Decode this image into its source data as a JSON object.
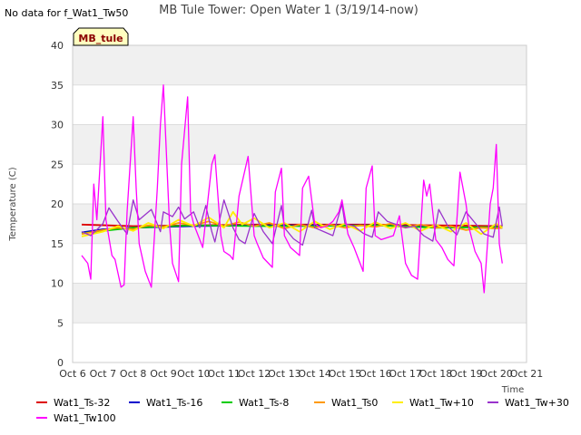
{
  "chart_data": {
    "type": "line",
    "title": "MB Tule Tower: Open Water 1 (3/19/14-now)",
    "no_data_note": "No data for f_Wat1_Tw50",
    "badge": "MB_tule",
    "xlabel": "Time",
    "ylabel": "Temperature (C)",
    "xlim": [
      6,
      21
    ],
    "ylim": [
      0,
      40
    ],
    "x_ticks": [
      6,
      7,
      8,
      9,
      10,
      11,
      12,
      13,
      14,
      15,
      16,
      17,
      18,
      19,
      20,
      21
    ],
    "x_tick_labels": [
      "Oct 6",
      "Oct 7",
      "Oct 8",
      "Oct 9",
      "Oct 10",
      "Oct 11",
      "Oct 12",
      "Oct 13",
      "Oct 14",
      "Oct 15",
      "Oct 16",
      "Oct 17",
      "Oct 18",
      "Oct 19",
      "Oct 20",
      "Oct 21"
    ],
    "y_ticks": [
      0,
      5,
      10,
      15,
      20,
      25,
      30,
      35,
      40
    ],
    "y_tick_labels": [
      "0",
      "5",
      "10",
      "15",
      "20",
      "25",
      "30",
      "35",
      "40"
    ],
    "grid": true,
    "legend_position": "bottom",
    "series": [
      {
        "name": "Wat1_Ts-32",
        "color": "#dd0000",
        "x": [
          6.3,
          8.0,
          10.0,
          12.0,
          14.0,
          16.0,
          18.0,
          20.2
        ],
        "y": [
          17.4,
          17.2,
          17.3,
          17.4,
          17.4,
          17.4,
          17.3,
          17.2
        ]
      },
      {
        "name": "Wat1_Ts-16",
        "color": "#0000cc",
        "x": [
          6.3,
          7.0,
          8.0,
          10.0,
          12.0,
          14.0,
          16.0,
          18.0,
          20.2
        ],
        "y": [
          16.4,
          16.8,
          17.0,
          17.2,
          17.3,
          17.3,
          17.3,
          17.1,
          17.0
        ]
      },
      {
        "name": "Wat1_Ts-8",
        "color": "#00cc00",
        "x": [
          6.3,
          7.0,
          8.0,
          10.0,
          12.0,
          14.0,
          16.0,
          18.0,
          20.2
        ],
        "y": [
          16.3,
          16.6,
          17.0,
          17.3,
          17.2,
          17.2,
          17.3,
          17.0,
          17.1
        ]
      },
      {
        "name": "Wat1_Ts0",
        "color": "#ff9900",
        "x": [
          6.3,
          7.0,
          7.5,
          8.0,
          8.5,
          9.0,
          9.5,
          10.0,
          10.5,
          11.0,
          11.5,
          12.0,
          12.5,
          13.0,
          13.5,
          14.0,
          14.5,
          15.0,
          15.5,
          16.0,
          16.5,
          17.0,
          17.5,
          18.0,
          18.5,
          19.0,
          19.5,
          20.0,
          20.2
        ],
        "y": [
          16.2,
          16.7,
          17.0,
          16.8,
          17.3,
          17.1,
          17.6,
          17.3,
          17.8,
          17.2,
          17.7,
          17.2,
          17.6,
          16.9,
          17.4,
          17.0,
          17.4,
          17.0,
          17.3,
          17.1,
          17.5,
          17.0,
          17.4,
          17.0,
          17.2,
          16.7,
          17.0,
          16.9,
          17.0
        ]
      },
      {
        "name": "Wat1_Tw+10",
        "color": "#ffee00",
        "x": [
          6.3,
          7.0,
          7.5,
          8.0,
          8.5,
          9.0,
          9.5,
          10.0,
          10.5,
          11.0,
          11.3,
          11.6,
          12.0,
          12.5,
          13.0,
          13.5,
          14.0,
          14.5,
          15.0,
          15.5,
          16.0,
          16.5,
          17.0,
          17.5,
          18.0,
          18.5,
          19.0,
          19.5,
          20.0,
          20.2
        ],
        "y": [
          15.9,
          16.5,
          17.2,
          16.6,
          17.6,
          16.9,
          18.0,
          17.2,
          18.3,
          17.0,
          19.0,
          17.4,
          18.2,
          17.0,
          17.6,
          16.5,
          17.8,
          16.8,
          17.5,
          16.6,
          17.7,
          16.9,
          17.6,
          16.6,
          17.4,
          16.5,
          17.6,
          16.2,
          17.5,
          17.0
        ]
      },
      {
        "name": "Wat1_Tw+30",
        "color": "#9933cc",
        "x": [
          6.3,
          6.6,
          7.0,
          7.2,
          7.5,
          7.8,
          8.0,
          8.2,
          8.6,
          8.9,
          9.0,
          9.3,
          9.5,
          9.7,
          10.0,
          10.2,
          10.4,
          10.6,
          10.7,
          11.0,
          11.3,
          11.5,
          11.7,
          12.0,
          12.3,
          12.6,
          12.9,
          13.0,
          13.3,
          13.6,
          13.9,
          14.0,
          14.3,
          14.6,
          14.9,
          15.0,
          15.3,
          15.6,
          15.9,
          16.1,
          16.4,
          16.7,
          17.0,
          17.3,
          17.6,
          17.9,
          18.1,
          18.4,
          18.7,
          19.0,
          19.3,
          19.6,
          19.9,
          20.1,
          20.2
        ],
        "y": [
          16.5,
          16.0,
          17.5,
          19.5,
          17.8,
          16.2,
          20.5,
          18.0,
          19.3,
          16.5,
          19.0,
          18.4,
          19.6,
          18.1,
          19.0,
          17.0,
          19.8,
          16.5,
          15.2,
          20.5,
          17.0,
          15.5,
          15.0,
          18.8,
          16.5,
          15.0,
          19.8,
          17.0,
          15.6,
          14.8,
          19.2,
          17.0,
          16.5,
          16.0,
          20.0,
          17.5,
          17.2,
          16.3,
          15.8,
          19.0,
          17.8,
          17.4,
          17.0,
          17.2,
          16.0,
          15.3,
          19.3,
          17.2,
          16.1,
          19.0,
          17.6,
          16.2,
          15.8,
          19.6,
          17.2
        ]
      },
      {
        "name": "Wat1_Tw100",
        "color": "#ff00ff",
        "x": [
          6.3,
          6.5,
          6.6,
          6.7,
          6.8,
          7.0,
          7.1,
          7.3,
          7.4,
          7.6,
          7.7,
          7.8,
          8.0,
          8.1,
          8.2,
          8.4,
          8.6,
          8.8,
          8.9,
          9.0,
          9.2,
          9.3,
          9.5,
          9.6,
          9.8,
          9.9,
          10.0,
          10.2,
          10.3,
          10.6,
          10.7,
          10.9,
          11.0,
          11.2,
          11.3,
          11.5,
          11.8,
          12.0,
          12.1,
          12.3,
          12.6,
          12.7,
          12.9,
          13.0,
          13.2,
          13.5,
          13.6,
          13.8,
          14.0,
          14.2,
          14.4,
          14.6,
          14.8,
          14.9,
          15.1,
          15.3,
          15.6,
          15.7,
          15.9,
          16.0,
          16.2,
          16.6,
          16.8,
          17.0,
          17.2,
          17.4,
          17.6,
          17.7,
          17.8,
          18.0,
          18.2,
          18.4,
          18.6,
          18.8,
          19.0,
          19.1,
          19.3,
          19.5,
          19.6,
          19.8,
          19.9,
          20.0,
          20.1,
          20.2
        ],
        "y": [
          13.5,
          12.5,
          10.5,
          22.5,
          18.0,
          31.0,
          18.0,
          13.5,
          13.0,
          9.5,
          9.8,
          19.0,
          31.0,
          22.0,
          15.0,
          11.5,
          9.5,
          22.0,
          30.0,
          35.0,
          17.5,
          12.5,
          10.2,
          25.0,
          33.5,
          19.0,
          17.5,
          15.5,
          14.5,
          25.0,
          26.2,
          16.0,
          14.0,
          13.5,
          13.0,
          21.0,
          26.0,
          16.0,
          15.0,
          13.2,
          12.0,
          21.5,
          24.5,
          16.0,
          14.5,
          13.5,
          22.0,
          23.5,
          17.5,
          17.0,
          17.2,
          17.8,
          19.0,
          20.5,
          16.2,
          14.5,
          11.5,
          22.0,
          24.8,
          16.0,
          15.5,
          16.0,
          18.5,
          12.5,
          11.0,
          10.5,
          23.0,
          21.0,
          22.5,
          15.5,
          14.5,
          13.0,
          12.2,
          24.0,
          20.0,
          17.0,
          14.0,
          12.5,
          8.8,
          20.0,
          22.0,
          27.5,
          15.0,
          12.5
        ]
      }
    ]
  }
}
